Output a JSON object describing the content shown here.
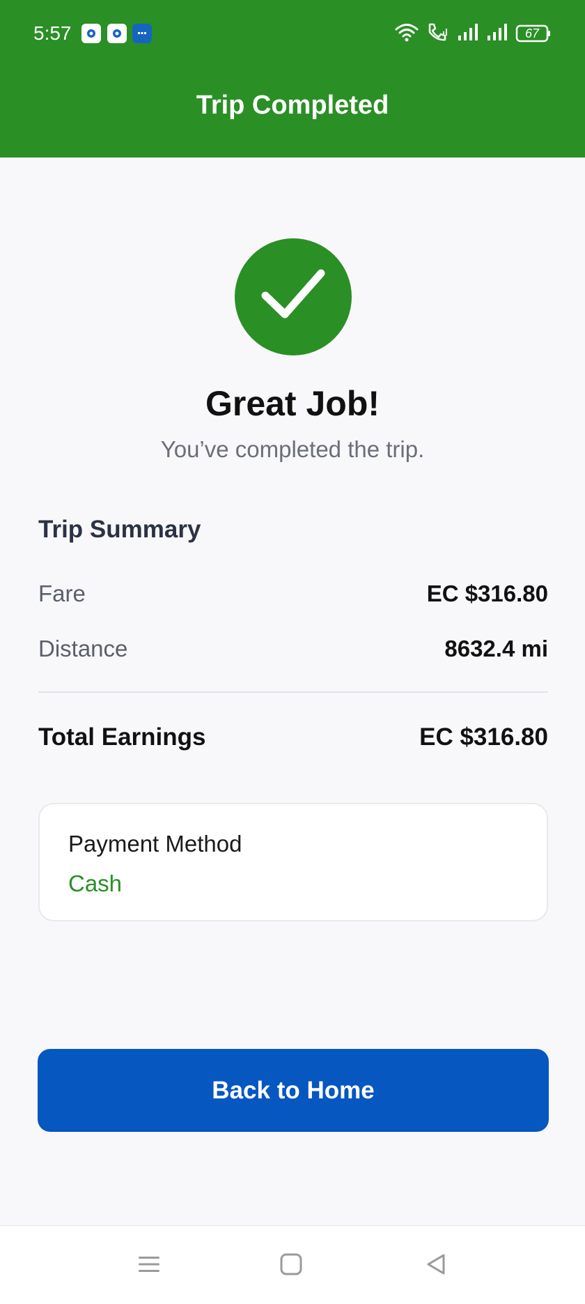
{
  "status_bar": {
    "time": "5:57",
    "battery": "67",
    "notification_icons": [
      "app-notification-icon",
      "app-notification-icon",
      "message-notification-icon"
    ],
    "right_icons": [
      "wifi-icon",
      "wifi-calling-icon",
      "signal-icon",
      "signal-icon",
      "battery-icon"
    ]
  },
  "header": {
    "title": "Trip Completed",
    "color": "#2a8f25"
  },
  "success": {
    "icon": "checkmark-icon",
    "headline": "Great Job!",
    "message": "You’ve completed the trip."
  },
  "summary": {
    "title": "Trip Summary",
    "rows": [
      {
        "label": "Fare",
        "value": "EC $316.80"
      },
      {
        "label": "Distance",
        "value": "8632.4 mi"
      }
    ],
    "total_label": "Total Earnings",
    "total_value": "EC $316.80"
  },
  "payment": {
    "title": "Payment Method",
    "value": "Cash",
    "value_color": "#2a8f25"
  },
  "actions": {
    "home_button_label": "Back to Home",
    "button_color": "#0757c0"
  },
  "nav": {
    "items": [
      "menu-icon",
      "home-icon",
      "back-icon"
    ]
  }
}
